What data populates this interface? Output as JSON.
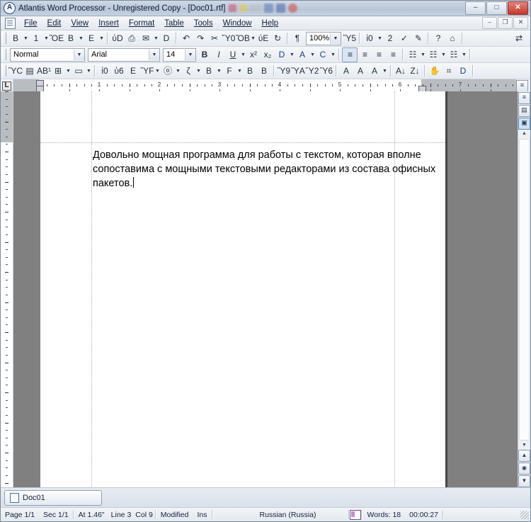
{
  "window": {
    "app_icon": "atlantis-logo-icon",
    "title": "Atlantis Word Processor - Unregistered Copy - [Doc01.rtf]",
    "controls": [
      {
        "name": "minimize-button",
        "glyph": "–"
      },
      {
        "name": "maximize-button",
        "glyph": "□"
      },
      {
        "name": "close-button",
        "glyph": "✕"
      }
    ],
    "title_blobs": [
      "#cf4a66",
      "#e8c840",
      "#b9bfc6",
      "#5b79b6",
      "#4a62a8",
      "#d0473f"
    ]
  },
  "menubar": {
    "doc_icon": "document-icon",
    "items": [
      {
        "name": "menu-file",
        "label": "File"
      },
      {
        "name": "menu-edit",
        "label": "Edit"
      },
      {
        "name": "menu-view",
        "label": "View"
      },
      {
        "name": "menu-insert",
        "label": "Insert"
      },
      {
        "name": "menu-format",
        "label": "Format"
      },
      {
        "name": "menu-table",
        "label": "Table"
      },
      {
        "name": "menu-tools",
        "label": "Tools"
      },
      {
        "name": "menu-window",
        "label": "Window"
      },
      {
        "name": "menu-help",
        "label": "Help"
      }
    ],
    "mdi_controls": [
      {
        "name": "mdi-minimize-button",
        "glyph": "–"
      },
      {
        "name": "mdi-restore-button",
        "glyph": "❐"
      },
      {
        "name": "mdi-close-button",
        "glyph": "✕"
      }
    ]
  },
  "toolbar_standard": [
    {
      "type": "button",
      "name": "new-document-icon",
      "glyph": "὜B"
    },
    {
      "type": "arrow",
      "name": "new-document-dropdown"
    },
    {
      "type": "button",
      "name": "open-folder-icon",
      "glyph": "὜1"
    },
    {
      "type": "arrow",
      "name": "open-dropdown"
    },
    {
      "type": "button",
      "name": "save-icon",
      "glyph": "ὋE"
    },
    {
      "type": "button",
      "name": "save-all-icon",
      "glyph": "὚B"
    },
    {
      "type": "arrow",
      "name": "save-dropdown"
    },
    {
      "type": "button",
      "name": "save-as-template-icon",
      "glyph": "὜E"
    },
    {
      "type": "arrow",
      "name": "template-dropdown"
    },
    {
      "type": "sep",
      "name": "toolbar-separator"
    },
    {
      "type": "button",
      "name": "print-preview-icon",
      "glyph": "ὐD"
    },
    {
      "type": "button",
      "name": "print-icon",
      "glyph": "⎙"
    },
    {
      "type": "button",
      "name": "send-mail-icon",
      "glyph": "✉"
    },
    {
      "type": "arrow",
      "name": "send-dropdown"
    },
    {
      "type": "button",
      "name": "page-setup-icon",
      "glyph": "὜D"
    },
    {
      "type": "sep",
      "name": "toolbar-separator"
    },
    {
      "type": "button",
      "name": "undo-icon",
      "glyph": "↶"
    },
    {
      "type": "button",
      "name": "redo-icon",
      "glyph": "↷"
    },
    {
      "type": "button",
      "name": "cut-icon",
      "glyph": "✂"
    },
    {
      "type": "button",
      "name": "copy-icon",
      "glyph": "Ὕ0"
    },
    {
      "type": "button",
      "name": "paste-icon",
      "glyph": "ὌB"
    },
    {
      "type": "arrow",
      "name": "paste-dropdown"
    },
    {
      "type": "button",
      "name": "find-icon",
      "glyph": "ὐE"
    },
    {
      "type": "button",
      "name": "replace-icon",
      "glyph": "↻"
    },
    {
      "type": "sep",
      "name": "toolbar-separator"
    },
    {
      "type": "button",
      "name": "show-formatting-marks-icon",
      "glyph": "¶"
    },
    {
      "type": "zoom",
      "name": "zoom-combo",
      "value": "100%"
    },
    {
      "type": "button",
      "name": "full-screen-icon",
      "glyph": "Ὓ5"
    },
    {
      "type": "sep",
      "name": "toolbar-separator"
    },
    {
      "type": "button",
      "name": "language-icon",
      "glyph": "ἱ0"
    },
    {
      "type": "arrow",
      "name": "language-dropdown"
    },
    {
      "type": "button",
      "name": "thesaurus-icon",
      "glyph": "὜2"
    },
    {
      "type": "button",
      "name": "spell-check-icon",
      "glyph": "✓"
    },
    {
      "type": "button",
      "name": "autocorrect-icon",
      "glyph": "✎"
    },
    {
      "type": "sep",
      "name": "toolbar-separator"
    },
    {
      "type": "button",
      "name": "help-icon",
      "glyph": "?"
    },
    {
      "type": "button",
      "name": "home-icon",
      "glyph": "⌂"
    },
    {
      "type": "sep",
      "name": "toolbar-separator"
    }
  ],
  "toolbar_standard_right": {
    "name": "switch-windows-icon",
    "glyph": "⇄"
  },
  "toolbar_formatting": {
    "style_combo": {
      "name": "paragraph-style-combo",
      "value": "Normal"
    },
    "font_combo": {
      "name": "font-name-combo",
      "value": "Arial"
    },
    "size_combo": {
      "name": "font-size-combo",
      "value": "14"
    },
    "buttons": [
      {
        "type": "button",
        "name": "bold-icon",
        "glyph": "B",
        "style": "bold"
      },
      {
        "type": "button",
        "name": "italic-icon",
        "glyph": "I",
        "style": "italic"
      },
      {
        "type": "button",
        "name": "underline-icon",
        "glyph": "U",
        "style": "underline"
      },
      {
        "type": "arrow",
        "name": "underline-dropdown"
      },
      {
        "type": "button",
        "name": "superscript-icon",
        "glyph": "x²"
      },
      {
        "type": "button",
        "name": "subscript-icon",
        "glyph": "x₂"
      },
      {
        "type": "button",
        "name": "highlight-color-icon",
        "glyph": "὘D"
      },
      {
        "type": "arrow",
        "name": "highlight-dropdown"
      },
      {
        "type": "button",
        "name": "font-color-icon",
        "glyph": "A"
      },
      {
        "type": "arrow",
        "name": "font-color-dropdown"
      },
      {
        "type": "button",
        "name": "format-painter-icon",
        "glyph": "὘C"
      },
      {
        "type": "arrow",
        "name": "format-painter-dropdown"
      },
      {
        "type": "sep",
        "name": "toolbar-separator"
      },
      {
        "type": "button",
        "name": "align-left-icon",
        "glyph": "≡",
        "selected": true
      },
      {
        "type": "button",
        "name": "align-center-icon",
        "glyph": "≡"
      },
      {
        "type": "button",
        "name": "align-right-icon",
        "glyph": "≡"
      },
      {
        "type": "button",
        "name": "align-justify-icon",
        "glyph": "≡"
      },
      {
        "type": "sep",
        "name": "toolbar-separator"
      },
      {
        "type": "button",
        "name": "bullet-list-icon",
        "glyph": "☷"
      },
      {
        "type": "arrow",
        "name": "bullet-list-dropdown"
      },
      {
        "type": "button",
        "name": "numbered-list-icon",
        "glyph": "☷"
      },
      {
        "type": "arrow",
        "name": "numbered-list-dropdown"
      },
      {
        "type": "button",
        "name": "multilevel-list-icon",
        "glyph": "☷"
      },
      {
        "type": "arrow",
        "name": "multilevel-list-dropdown"
      },
      {
        "type": "sep",
        "name": "toolbar-separator"
      }
    ]
  },
  "toolbar_extra": [
    {
      "type": "button",
      "name": "insert-image-icon",
      "glyph": "ὛC"
    },
    {
      "type": "button",
      "name": "insert-textbox-icon",
      "glyph": "▤"
    },
    {
      "type": "button",
      "name": "drop-cap-icon",
      "glyph": "AB¹"
    },
    {
      "type": "button",
      "name": "insert-table-icon",
      "glyph": "⊞"
    },
    {
      "type": "arrow",
      "name": "insert-table-dropdown"
    },
    {
      "type": "button",
      "name": "insert-frame-icon",
      "glyph": "▭"
    },
    {
      "type": "arrow",
      "name": "insert-frame-dropdown"
    },
    {
      "type": "sep",
      "name": "toolbar-separator"
    },
    {
      "type": "button",
      "name": "insert-hyperlink-icon",
      "glyph": "ἱ0"
    },
    {
      "type": "button",
      "name": "insert-bookmark-icon",
      "glyph": "ὑ6"
    },
    {
      "type": "button",
      "name": "insert-file-icon",
      "glyph": "὜E"
    },
    {
      "type": "button",
      "name": "insert-object-icon",
      "glyph": "ὛF"
    },
    {
      "type": "arrow",
      "name": "insert-object-dropdown"
    },
    {
      "type": "button",
      "name": "insert-symbol-icon",
      "glyph": "ⓞ"
    },
    {
      "type": "arrow",
      "name": "insert-symbol-dropdown"
    },
    {
      "type": "button",
      "name": "insert-footnote-icon",
      "glyph": "ζ"
    },
    {
      "type": "arrow",
      "name": "insert-footnote-dropdown"
    },
    {
      "type": "button",
      "name": "insert-page-break-icon",
      "glyph": "὜B"
    },
    {
      "type": "arrow",
      "name": "page-break-dropdown"
    },
    {
      "type": "button",
      "name": "insert-section-break-icon",
      "glyph": "὜F"
    },
    {
      "type": "arrow",
      "name": "section-break-dropdown"
    },
    {
      "type": "button",
      "name": "insert-column-break-icon",
      "glyph": "὜B"
    },
    {
      "type": "button",
      "name": "insert-line-break-icon",
      "glyph": "὜B"
    },
    {
      "type": "sep",
      "name": "toolbar-separator"
    },
    {
      "type": "button",
      "name": "header-footer-icon",
      "glyph": "Ὓ9"
    },
    {
      "type": "button",
      "name": "page-number-icon",
      "glyph": "ὛA"
    },
    {
      "type": "button",
      "name": "comment-icon",
      "glyph": "Ὕ2"
    },
    {
      "type": "button",
      "name": "annotation-icon",
      "glyph": "Ὓ6"
    },
    {
      "type": "sep",
      "name": "toolbar-separator"
    },
    {
      "type": "button",
      "name": "increase-font-size-icon",
      "glyph": "A"
    },
    {
      "type": "button",
      "name": "decrease-font-size-icon",
      "glyph": "A"
    },
    {
      "type": "button",
      "name": "change-case-icon",
      "glyph": "A"
    },
    {
      "type": "arrow",
      "name": "change-case-dropdown"
    },
    {
      "type": "sep",
      "name": "toolbar-separator"
    },
    {
      "type": "button",
      "name": "sort-ascending-icon",
      "glyph": "A↓"
    },
    {
      "type": "button",
      "name": "sort-descending-icon",
      "glyph": "Z↓"
    },
    {
      "type": "sep",
      "name": "toolbar-separator"
    },
    {
      "type": "button",
      "name": "hand-tool-icon",
      "glyph": "✋"
    },
    {
      "type": "button",
      "name": "select-browser-icon",
      "glyph": "⌗"
    },
    {
      "type": "button",
      "name": "highlighter-tool-icon",
      "glyph": "὘D"
    },
    {
      "type": "sep",
      "name": "toolbar-separator"
    }
  ],
  "ruler": {
    "tab_stop_selector": {
      "name": "tab-stop-selector",
      "glyph": "L"
    },
    "unit": "inch",
    "numbers": [
      1,
      2,
      3,
      4,
      5,
      6,
      7
    ],
    "left_indent_marker": "first-line-indent-marker",
    "right_indent_marker": "right-indent-marker",
    "view_buttons": [
      {
        "name": "normal-view-button",
        "glyph": "≡"
      },
      {
        "name": "print-layout-view-button",
        "glyph": "▤"
      },
      {
        "name": "page-view-button",
        "glyph": "▣",
        "active": true
      }
    ]
  },
  "document": {
    "paragraph": "Довольно мощная программа для работы с текстом, которая вполне сопоставима с мощными текстовыми редакторами из состава офисных пакетов.",
    "caret_visible": true
  },
  "scrollbar": {
    "up_arrow": "▲",
    "down_arrow": "▼",
    "browse_prev": "▲",
    "browse_select": "◉",
    "browse_next": "▼"
  },
  "tabstrip": {
    "tabs": [
      {
        "name": "document-tab-doc01",
        "label": "Doc01",
        "icon": "document-icon",
        "active": true
      }
    ]
  },
  "statusbar": {
    "page": "Page 1/1",
    "section": "Sec 1/1",
    "position": "At 1.46\"",
    "line": "Line 3",
    "column": "Col 9",
    "modified": "Modified",
    "insert_mode": "Ins",
    "language": "Russian (Russia)",
    "spell_icon": "spell-check-book-icon",
    "words": "Words: 18",
    "time": "00:00:27"
  }
}
